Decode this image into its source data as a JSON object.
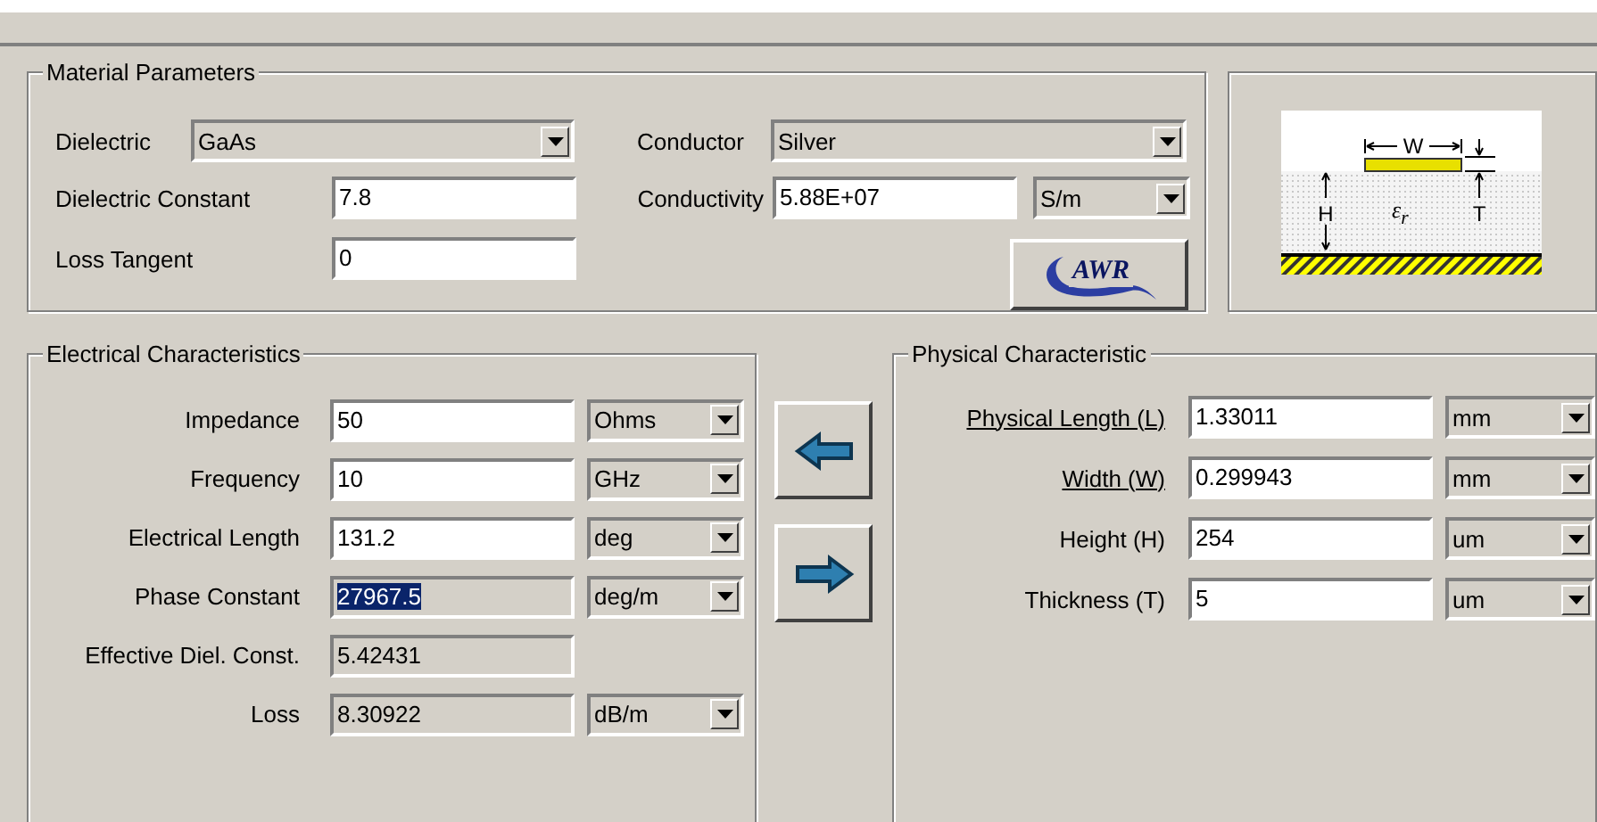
{
  "material": {
    "title": "Material Parameters",
    "dielectric": {
      "label": "Dielectric",
      "value": "GaAs"
    },
    "conductor": {
      "label": "Conductor",
      "value": "Silver"
    },
    "dielectric_constant": {
      "label": "Dielectric Constant",
      "value": "7.8"
    },
    "conductivity": {
      "label": "Conductivity",
      "value": "5.88E+07",
      "unit": "S/m"
    },
    "loss_tangent": {
      "label": "Loss Tangent",
      "value": "0"
    },
    "logo_button": {
      "label": "AWR"
    }
  },
  "diagram": {
    "width_label": "W",
    "height_label": "H",
    "thickness_label": "T",
    "permittivity_label": "ε$_{r}$"
  },
  "electrical": {
    "title": "Electrical Characteristics",
    "rows": [
      {
        "label": "Impedance",
        "value": "50",
        "editable": true,
        "highlighted": false,
        "unit": "Ohms"
      },
      {
        "label": "Frequency",
        "value": "10",
        "editable": true,
        "highlighted": false,
        "unit": "GHz"
      },
      {
        "label": "Electrical Length",
        "value": "131.2",
        "editable": true,
        "highlighted": false,
        "unit": "deg"
      },
      {
        "label": "Phase Constant",
        "value": "27967.5",
        "editable": false,
        "highlighted": true,
        "unit": "deg/m"
      },
      {
        "label": "Effective Diel. Const.",
        "value": "5.42431",
        "editable": false,
        "highlighted": false
      },
      {
        "label": "Loss",
        "value": "8.30922",
        "editable": false,
        "highlighted": false,
        "unit": "dB/m"
      }
    ]
  },
  "physical": {
    "title": "Physical Characteristic",
    "rows": [
      {
        "label": "Physical Length (L)",
        "underlined": true,
        "value": "1.33011",
        "unit": "mm"
      },
      {
        "label": "Width (W)",
        "underlined": true,
        "value": "0.299943",
        "unit": "mm"
      },
      {
        "label": "Height (H)",
        "underlined": false,
        "value": "254",
        "unit": "um"
      },
      {
        "label": "Thickness (T)",
        "underlined": false,
        "value": "5",
        "unit": "um"
      }
    ]
  }
}
